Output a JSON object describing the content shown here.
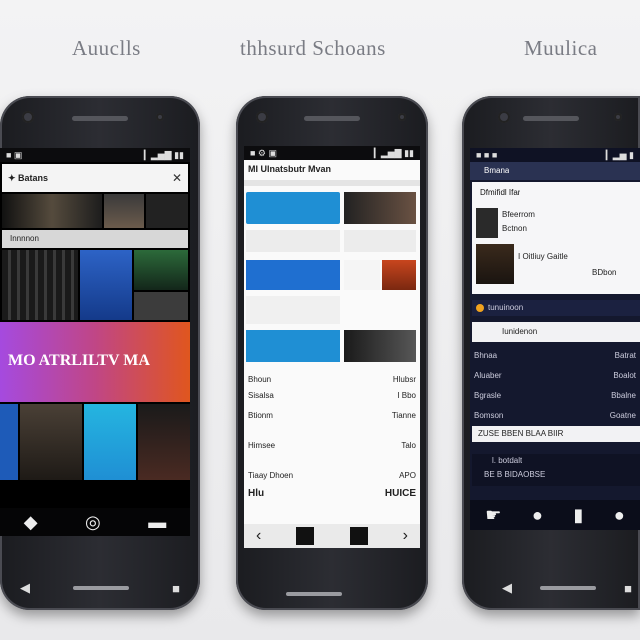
{
  "labels": {
    "left": "Auuclls",
    "middle": "thhsurd Schoans",
    "right": "Muulica"
  },
  "phone1": {
    "status_left": "■ ▣",
    "status_right": "▎▂▅▇ ▮▮",
    "app_title": "✦ Batans",
    "close": "✕",
    "section": "Innnnon",
    "banner_text": "MO ATRLILTV MA",
    "nav": [
      "◆",
      "◎",
      "▬"
    ],
    "colors": {
      "banner_from": "#a54adf",
      "banner_to": "#e0561e",
      "accent": "#1f8fd4"
    }
  },
  "phone2": {
    "status_left": "■ ⚙ ▣",
    "status_right": "▎▂▅▇ ▮▮",
    "header": "MI Ulnatsbutr Mvan",
    "rows": [
      {
        "left": "Bhoun",
        "right": "Hlubsr"
      },
      {
        "left": "Sisalsa",
        "right": "I Bbo"
      },
      {
        "left": "Btionm",
        "right": "Tianne"
      },
      {
        "left": "Himsee",
        "right": "Talo"
      },
      {
        "left": "Tiaay Dhoen",
        "right": "APO"
      }
    ],
    "footer_left": "Hlu",
    "footer_right": "HUICE",
    "nav": [
      "‹",
      "›"
    ]
  },
  "phone3": {
    "status_left": "■ ■ ■",
    "status_right": "▎▂▅ ▮",
    "app_title": "Bmana",
    "card_title": "Dfmifidl Ifar",
    "card_line1": "Bfeerrom",
    "card_line2": "Bctnon",
    "card_line3": "I Oitliuy   Gaitle",
    "card_side": "BDbon",
    "search_label": "tunuinoon",
    "section": "Iunidenon",
    "list": [
      {
        "left": "Bhnaa",
        "right": "Batrat"
      },
      {
        "left": "Aluaber",
        "right": "Boalot"
      },
      {
        "left": "Bgrasle",
        "right": "Bbalne"
      },
      {
        "left": "Bomson",
        "right": "Goatne"
      }
    ],
    "footer_bar": "ZUSE   BBEN BLAA BIIR",
    "mini_title": "l. botdalt",
    "mini_sub": "BE B BIDAOBSE",
    "nav": [
      "☛",
      "●",
      "▮",
      "●"
    ]
  }
}
